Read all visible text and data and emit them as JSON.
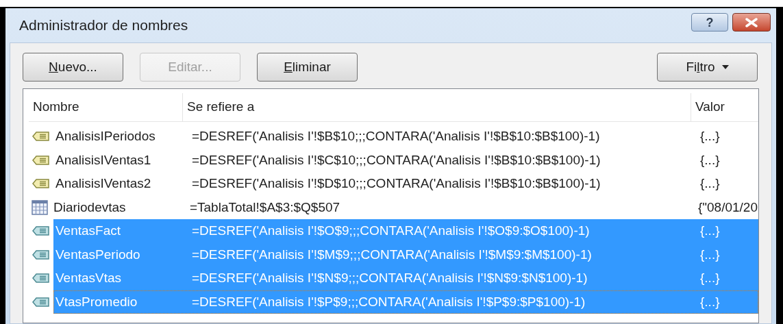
{
  "window": {
    "title": "Administrador de nombres",
    "title_buttons": [
      {
        "kind": "help",
        "label": "?"
      },
      {
        "kind": "close"
      }
    ]
  },
  "toolbar": [
    {
      "label": "Nuevo...",
      "disabled": false
    },
    {
      "label": "Editar...",
      "disabled": true
    },
    {
      "label": "Eliminar",
      "disabled": false
    }
  ],
  "filter_button": {
    "label": "Filtro"
  },
  "table": {
    "columns": [
      "Nombre",
      "Se refiere a",
      "Valor"
    ],
    "rows": [
      {
        "kind": "range",
        "name": "AnalisisIPeriodos",
        "refers_to": "=DESREF('Analisis I'!$B$10;;;CONTARA('Analisis I'!$B$10:$B$100)-1)",
        "value": "{...}",
        "selected": false,
        "focused": false
      },
      {
        "kind": "range",
        "name": "AnalisisIVentas1",
        "refers_to": "=DESREF('Analisis I'!$C$10;;;CONTARA('Analisis I'!$B$10:$B$100)-1)",
        "value": "{...}",
        "selected": false,
        "focused": false
      },
      {
        "kind": "range",
        "name": "AnalisisIVentas2",
        "refers_to": "=DESREF('Analisis I'!$D$10;;;CONTARA('Analisis I'!$B$10:$B$100)-1)",
        "value": "{...}",
        "selected": false,
        "focused": false
      },
      {
        "kind": "table",
        "name": "Diariodevtas",
        "refers_to": "=TablaTotal!$A$3:$Q$507",
        "value": "{\"08/01/20",
        "selected": false,
        "focused": false
      },
      {
        "kind": "range",
        "name": "VentasFact",
        "refers_to": "=DESREF('Analisis I'!$O$9;;;CONTARA('Analisis I'!$O$9:$O$100)-1)",
        "value": "{...}",
        "selected": true,
        "focused": false
      },
      {
        "kind": "range",
        "name": "VentasPeriodo",
        "refers_to": "=DESREF('Analisis I'!$M$9;;;CONTARA('Analisis I'!$M$9:$M$100)-1)",
        "value": "{...}",
        "selected": true,
        "focused": false
      },
      {
        "kind": "range",
        "name": "VentasVtas",
        "refers_to": "=DESREF('Analisis I'!$N$9;;;CONTARA('Analisis I'!$N$9:$N$100)-1)",
        "value": "{...}",
        "selected": true,
        "focused": false
      },
      {
        "kind": "range",
        "name": "VtasPromedio",
        "refers_to": "=DESREF('Analisis I'!$P$9;;;CONTARA('Analisis I'!$P$9:$P$100)-1)",
        "value": "{...}",
        "selected": true,
        "focused": true
      }
    ]
  }
}
